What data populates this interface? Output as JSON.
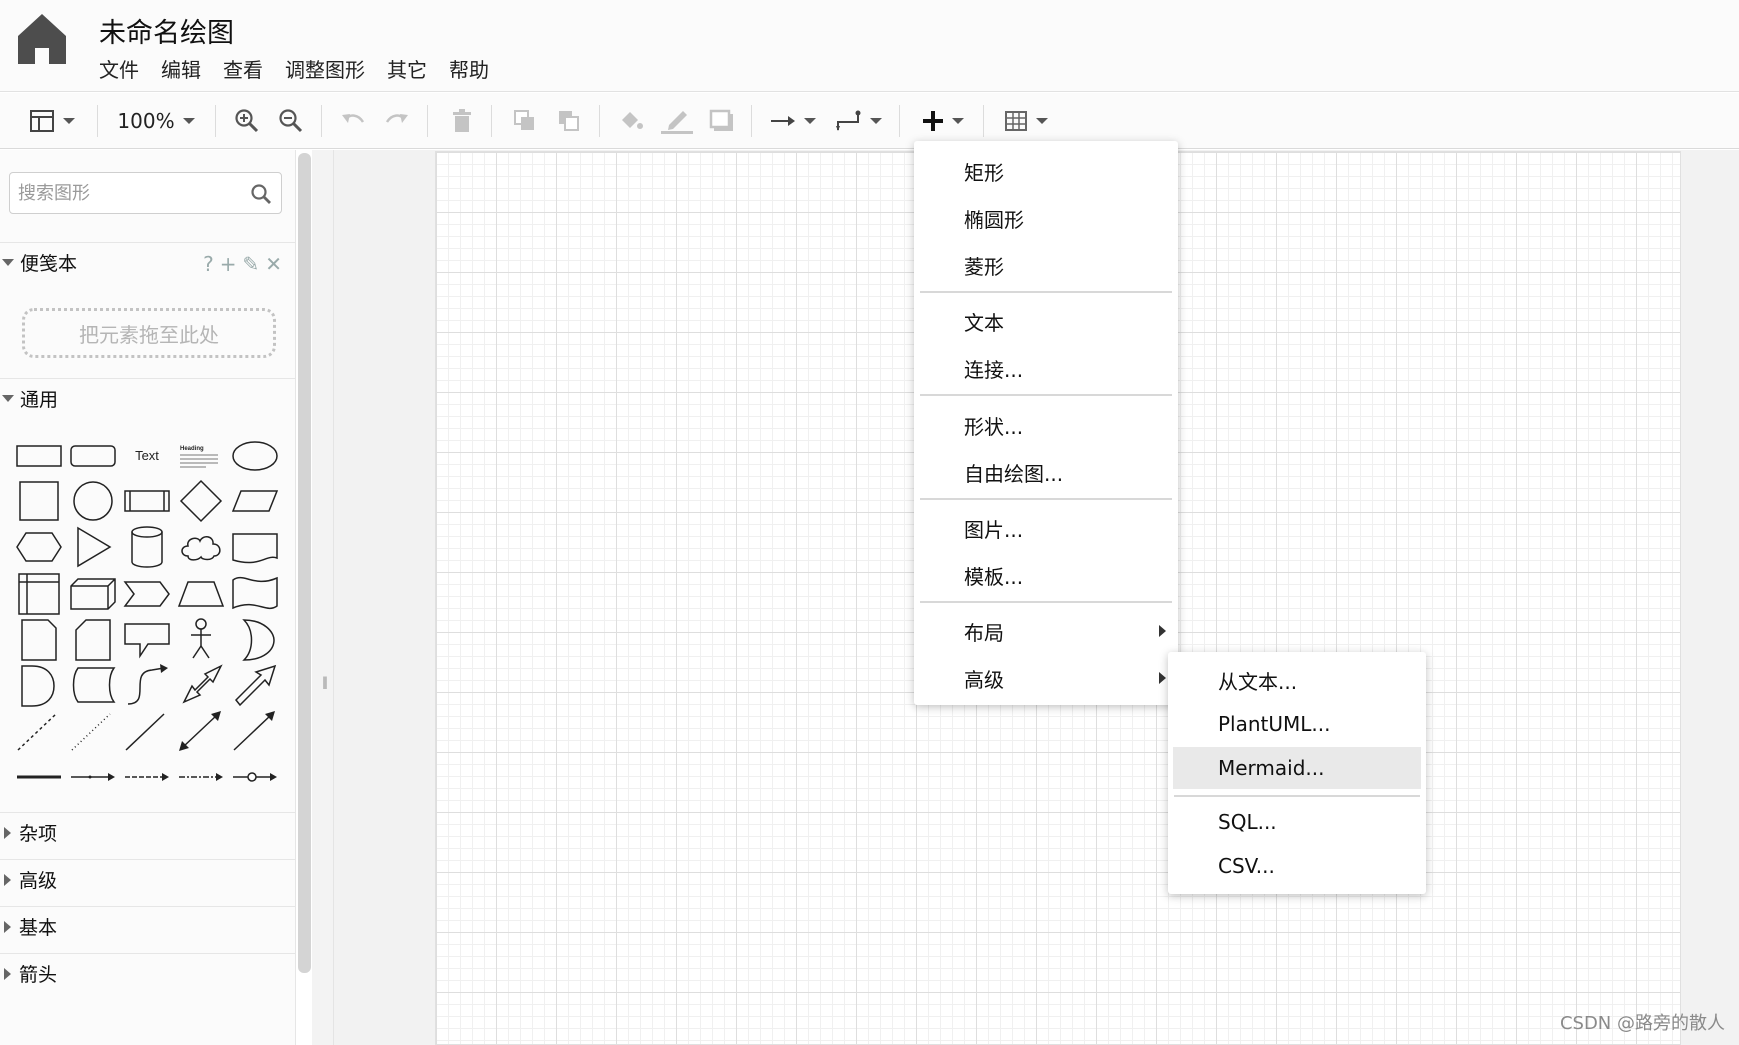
{
  "header": {
    "title": "未命名绘图",
    "menus": [
      "文件",
      "编辑",
      "查看",
      "调整图形",
      "其它",
      "帮助"
    ]
  },
  "toolbar": {
    "zoom": "100%"
  },
  "sidebar": {
    "search_placeholder": "搜索图形",
    "sections": {
      "scratchpad": "便笺本",
      "general": "通用",
      "misc": "杂项",
      "advanced": "高级",
      "basic": "基本",
      "arrows": "箭头"
    },
    "scratchpad_tools": [
      "?",
      "+",
      "✎",
      "✕"
    ],
    "drop_hint": "把元素拖至此处",
    "shape_texts": {
      "text": "Text",
      "heading": "Heading"
    }
  },
  "insert_menu": {
    "items": [
      "矩形",
      "椭圆形",
      "菱形",
      "文本",
      "连接...",
      "形状...",
      "自由绘图...",
      "图片...",
      "模板...",
      "布局",
      "高级"
    ]
  },
  "advanced_submenu": {
    "items": [
      "从文本...",
      "PlantUML...",
      "Mermaid...",
      "SQL...",
      "CSV..."
    ],
    "highlighted": "Mermaid..."
  },
  "watermark": "CSDN @路旁的散人"
}
